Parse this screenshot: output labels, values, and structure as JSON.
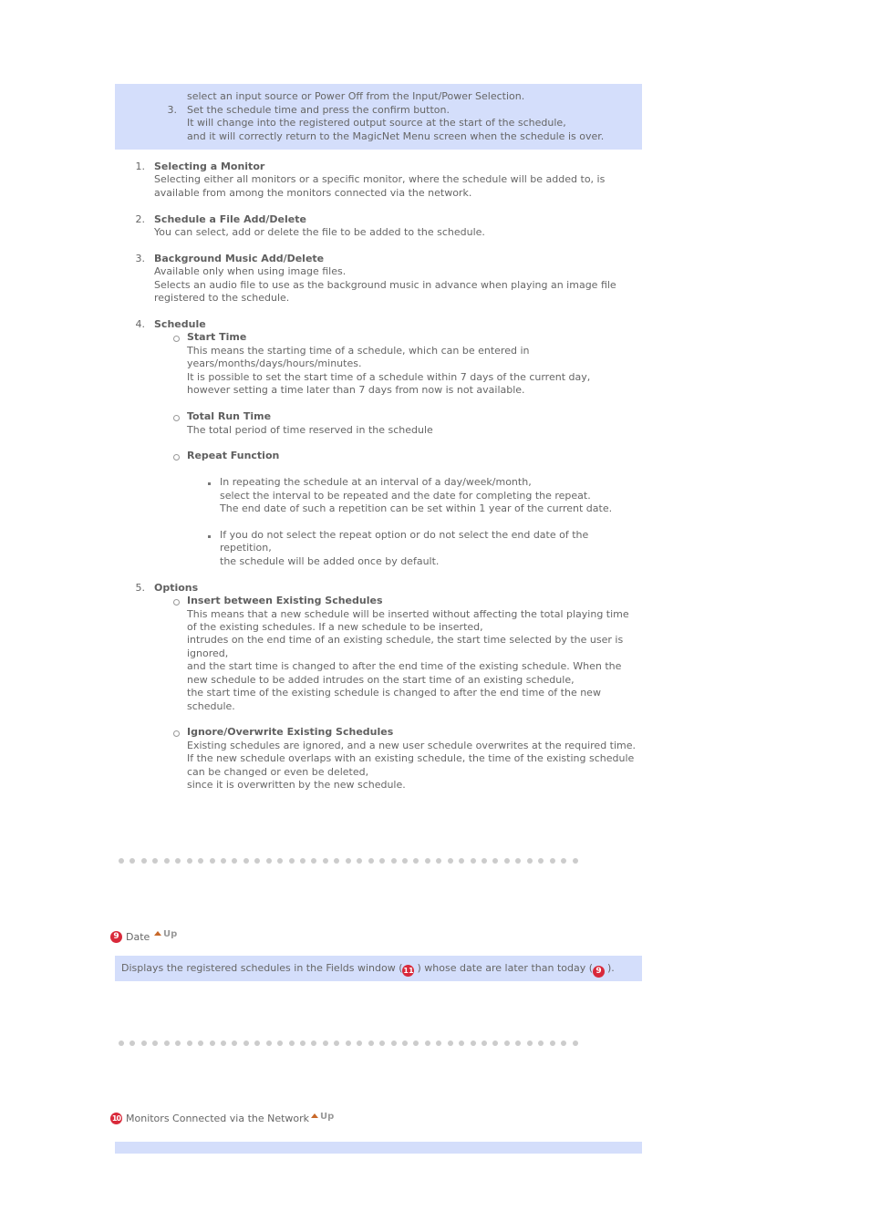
{
  "top_box": {
    "lines": [
      "select an input source or Power Off from the Input/Power Selection.",
      "Set the schedule time and press the confirm button.",
      "It will change into the registered output source at the start of the schedule,",
      "and it will correctly return to the MagicNet Menu screen when the schedule is over."
    ],
    "step_number": "3."
  },
  "items": [
    {
      "number": "1.",
      "title": "Selecting a Monitor",
      "lines": [
        "Selecting either all monitors or a specific monitor, where the schedule will be added to, is",
        "available from among the monitors connected via the network."
      ]
    },
    {
      "number": "2.",
      "title": "Schedule a File Add/Delete",
      "lines": [
        "You can select, add or delete the file to be added to the schedule."
      ]
    },
    {
      "number": "3.",
      "title": "Background Music Add/Delete",
      "lines": [
        "Available only when using image files.",
        "Selects an audio file to use as the background music in advance when playing an image file",
        "registered to the schedule."
      ]
    },
    {
      "number": "4.",
      "title": "Schedule",
      "sub": [
        {
          "title": "Start Time",
          "lines": [
            "This means the starting time of a schedule, which can be entered in",
            "years/months/days/hours/minutes.",
            "It is possible to set the start time of a schedule within 7 days of the current day,",
            "however setting a time later than 7 days from now is not available."
          ]
        },
        {
          "title": "Total Run Time",
          "lines": [
            "The total period of time reserved in the schedule"
          ]
        },
        {
          "title": "Repeat Function",
          "bullets": [
            [
              "In repeating the schedule at an interval of a day/week/month,",
              "select the interval to be repeated and the date for completing the repeat.",
              "The end date of such a repetition can be set within 1 year of the current date."
            ],
            [
              "If you do not select the repeat option or do not select the end date of the",
              "repetition,",
              "the schedule will be added once by default."
            ]
          ]
        }
      ]
    },
    {
      "number": "5.",
      "title": "Options",
      "sub": [
        {
          "title": "Insert between Existing Schedules",
          "lines": [
            "This means that a new schedule will be inserted without affecting the total playing time",
            "of the existing schedules. If a new schedule to be inserted,",
            "intrudes on the end time of an existing schedule, the start time selected by the user is",
            "ignored,",
            "and the start time is changed to after the end time of the existing schedule. When the",
            "new schedule to be added intrudes on the start time of an existing schedule,",
            "the start time of the existing schedule is changed to after the end time of the new",
            "schedule."
          ]
        },
        {
          "title": "Ignore/Overwrite Existing Schedules",
          "lines": [
            "Existing schedules are ignored, and a new user schedule overwrites at the required time.",
            "If the new schedule overlaps with an existing schedule, the time of the existing schedule",
            "can be changed or even be deleted,",
            "since it is overwritten by the new schedule."
          ]
        }
      ]
    }
  ],
  "section_date": {
    "badge": "9",
    "title": "Date",
    "up_label": "Up",
    "desc_before": "Displays the registered schedules in the Fields window (",
    "desc_badge1": "11",
    "desc_middle": ") whose date are later than today (",
    "desc_badge2": "9",
    "desc_after": ")."
  },
  "section_monitors": {
    "badge": "10",
    "title": "Monitors Connected via the Network",
    "up_label": "Up"
  },
  "colors": {
    "box_bg": "#d4defb",
    "badge_red": "#d9293a",
    "up_arrow": "#c8692a",
    "dot": "#cccccc",
    "text": "#666666"
  }
}
